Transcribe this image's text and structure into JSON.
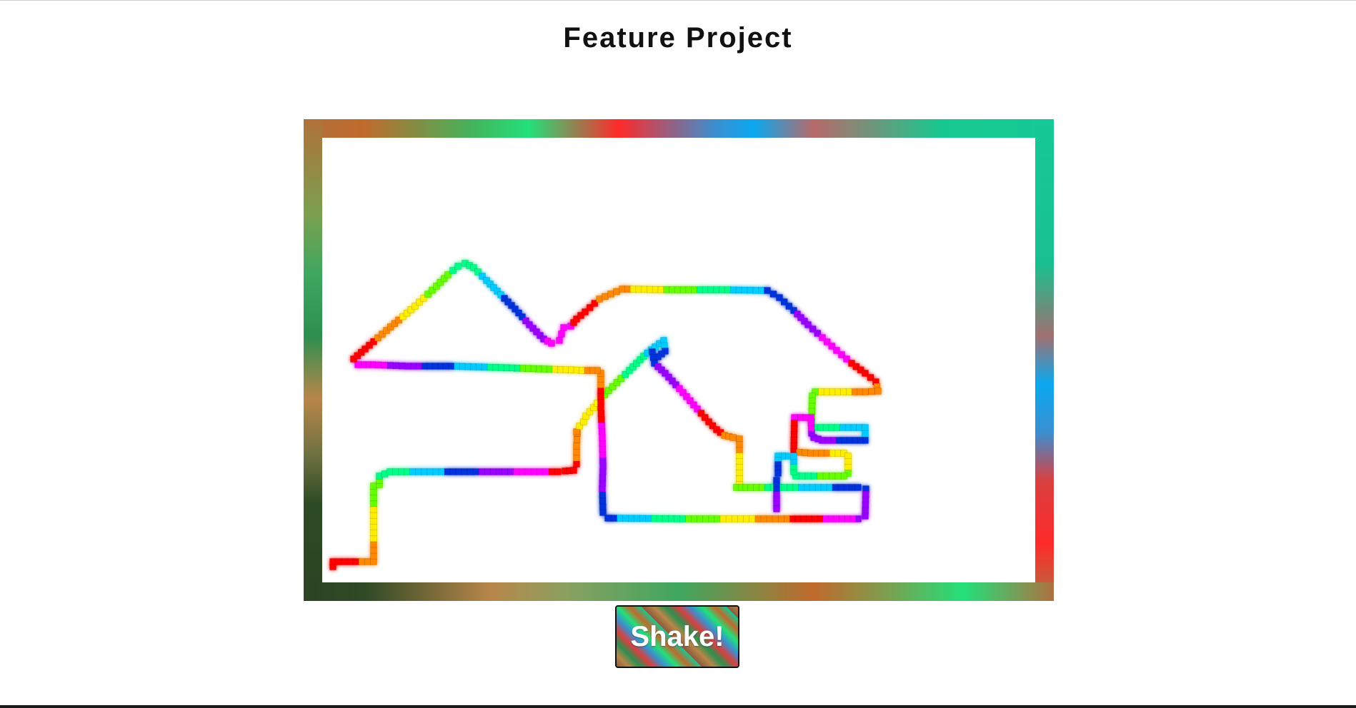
{
  "page": {
    "title": "Feature Project"
  },
  "controls": {
    "shake_label": "Shake!"
  },
  "colors": {
    "trail_spectrum": [
      "#ff0000",
      "#ff8800",
      "#ffee00",
      "#66ff00",
      "#00ff88",
      "#00ccff",
      "#0033dd",
      "#9900ff",
      "#ff00ff"
    ],
    "frame_spectrum": [
      "#b0713a",
      "#c06a2c",
      "#47b15a",
      "#23e07a",
      "#ff2a2a",
      "#3a8fd0",
      "#0aa8f0",
      "#16c996",
      "#2d4324",
      "#b8864a"
    ]
  }
}
